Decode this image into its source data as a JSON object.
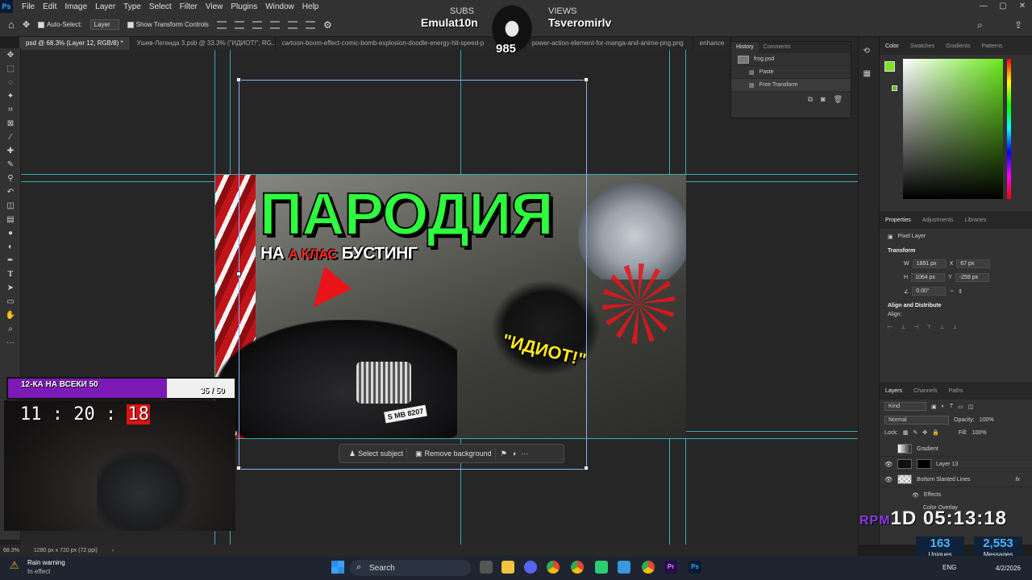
{
  "app": {
    "logo": "Ps"
  },
  "menu": [
    "File",
    "Edit",
    "Image",
    "Layer",
    "Type",
    "Select",
    "Filter",
    "View",
    "Plugins",
    "Window",
    "Help"
  ],
  "options": {
    "auto_select": "Auto-Select:",
    "layer_dropdown": "Layer",
    "show_transform": "Show Transform Controls"
  },
  "tabs": [
    "psd @ 68.3% (Layer 12, RGB/8) *",
    "Ушев-Легенда 3.psb @ 33.3% (\"ИДИОТ!\", RG...",
    "cartoon-boom-effect-comic-bomb-explosion-doodle-energy-hit-speed-p",
    "power-action-element-for-manga-and-anime-png.png",
    "enhance"
  ],
  "thumbnail": {
    "title": "ПАРОДИЯ",
    "subtitle_pre": "НА ",
    "subtitle_red": "А КЛАС",
    "subtitle_post": " БУСТИНГ",
    "caption": "\"ИДИОТ!\"",
    "plate": "S MB 8207"
  },
  "context_bar": {
    "select_subject": "Select subject",
    "remove_background": "Remove background",
    "more": "···"
  },
  "history": {
    "tabs": [
      "History",
      "Comments"
    ],
    "file": "frog.psd",
    "items": [
      "Paste",
      "Free Transform"
    ]
  },
  "color_panel": {
    "tabs": [
      "Color",
      "Swatches",
      "Gradients",
      "Patterns"
    ],
    "fg": "#7fe21e"
  },
  "properties": {
    "tabs": [
      "Properties",
      "Adjustments",
      "Libraries"
    ],
    "kind": "Pixel Layer",
    "transform_title": "Transform",
    "w": "1891 px",
    "x": "67 px",
    "h": "1064 px",
    "y": "-259 px",
    "angle": "0.00°",
    "align_title": "Align and Distribute",
    "align_label": "Align:"
  },
  "layers": {
    "tabs": [
      "Layers",
      "Channels",
      "Paths"
    ],
    "kind": "Kind",
    "blend": "Normal",
    "opacity_label": "Opacity:",
    "opacity": "100%",
    "lock_label": "Lock:",
    "fill_label": "Fill:",
    "fill": "100%",
    "rows": [
      "Gradient",
      "Layer 13",
      "Bottom Slanted Lines"
    ],
    "effects": "Effects",
    "color_overlay": "Color Overlay"
  },
  "stream": {
    "goal_label": "12-КА НА ВСЕКИ 50",
    "goal_count": "35 / 50",
    "goal_progress": 0.7,
    "timer_main": "11 : 20 : ",
    "timer_sec": "18",
    "subs_label": "SUBS",
    "subs_name": "Emulat10n",
    "views_label": "VIEWS",
    "views_name": "Tsveromirlv",
    "mascot_num": "985",
    "session_prefix": "RPM",
    "session_time": "1D 05:13:18",
    "uniques": "163",
    "uniques_label": "Uniques",
    "messages": "2,553",
    "messages_label": "Messages"
  },
  "status": {
    "zoom": "68.3%",
    "doc_size": "1280 px x 720 px (72 ppi)"
  },
  "taskbar": {
    "weather_title": "Rain warning",
    "weather_sub": "In effect",
    "search": "Search",
    "lang": "ENG",
    "date": "4/2/2026"
  }
}
